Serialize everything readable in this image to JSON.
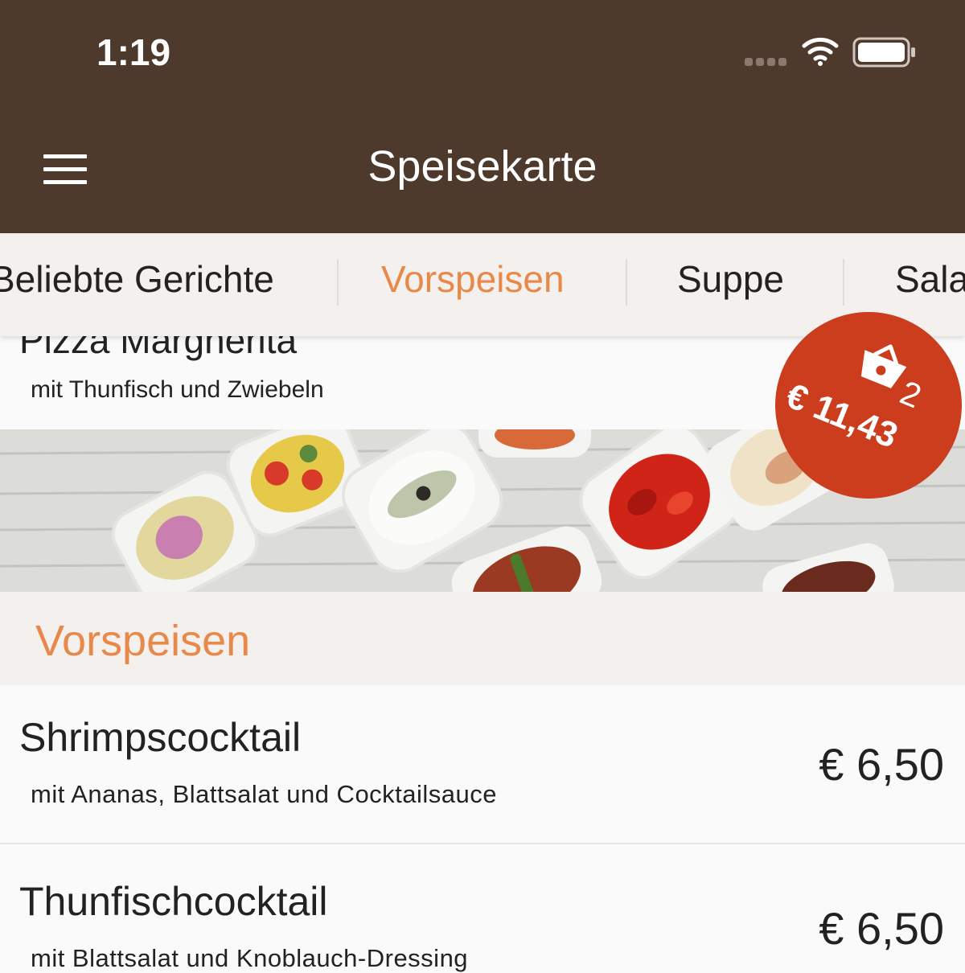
{
  "status_bar": {
    "time": "1:19"
  },
  "navbar": {
    "title": "Speisekarte"
  },
  "tabs": [
    {
      "label": "Beliebte Gerichte",
      "active": false
    },
    {
      "label": "Vorspeisen",
      "active": true
    },
    {
      "label": "Suppe",
      "active": false
    },
    {
      "label": "Sala",
      "active": false
    }
  ],
  "previous_item": {
    "name": "Pizza Margherita",
    "description": "mit Thunfisch und Zwiebeln"
  },
  "section": {
    "title": "Vorspeisen"
  },
  "items": [
    {
      "name": "Shrimpscocktail",
      "description": "mit Ananas, Blattsalat und Cocktailsauce",
      "price": "€ 6,50"
    },
    {
      "name": "Thunfischcocktail",
      "description": "mit Blattsalat und Knoblauch-Dressing",
      "price": "€ 6,50"
    }
  ],
  "cart": {
    "count": "2",
    "total": "€ 11,43"
  },
  "colors": {
    "brand": "#4e3a2c",
    "accent": "#e8894a",
    "cart_badge": "#cc3d1e"
  }
}
